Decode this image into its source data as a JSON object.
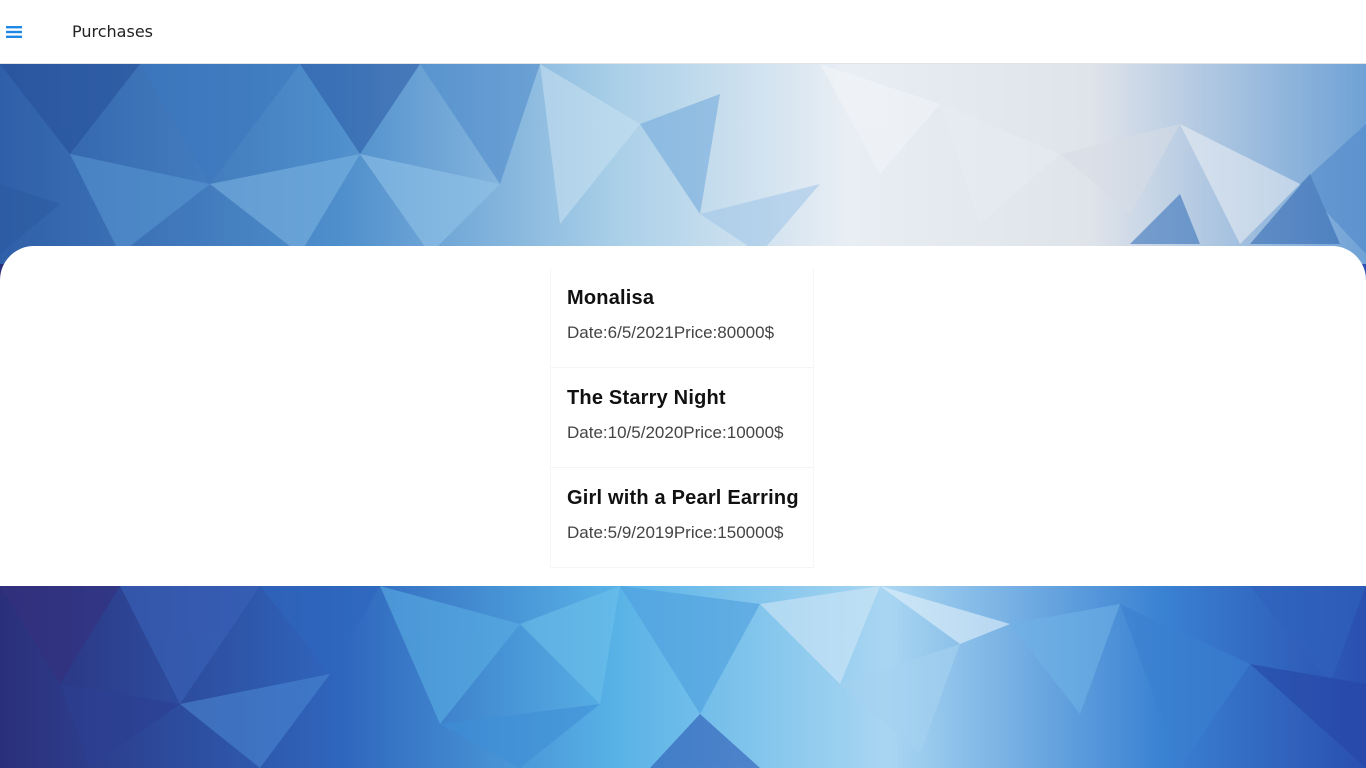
{
  "header": {
    "title": "Purchases",
    "menu_icon": "hamburger-menu-icon"
  },
  "colors": {
    "accent": "#1e88e5",
    "background_dark": "#2b4f9e",
    "background_light": "#8fc3ec"
  },
  "purchases": [
    {
      "title": "Monalisa",
      "date_label": "Date:",
      "date": "6/5/2021",
      "price_label": "Price:",
      "price": "80000$"
    },
    {
      "title": "The Starry Night",
      "date_label": "Date:",
      "date": "10/5/2020",
      "price_label": "Price:",
      "price": "10000$"
    },
    {
      "title": "Girl with a Pearl Earring",
      "date_label": "Date:",
      "date": "5/9/2019",
      "price_label": "Price:",
      "price": "150000$"
    }
  ]
}
